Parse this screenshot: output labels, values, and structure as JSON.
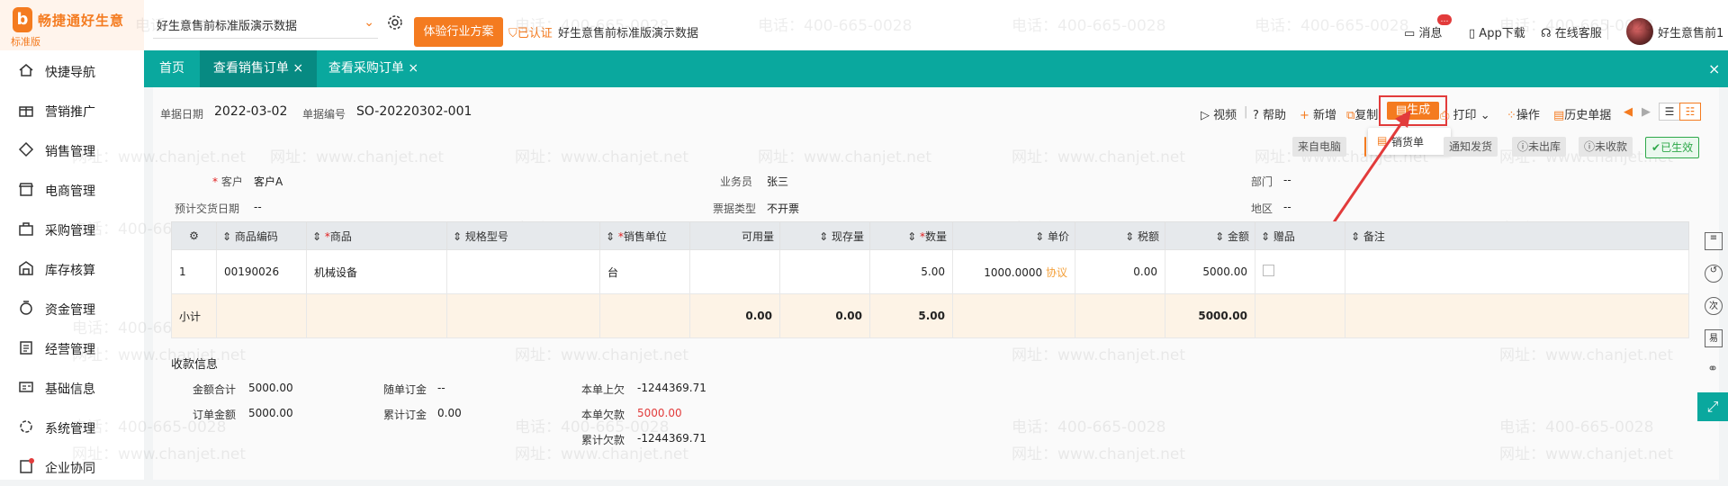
{
  "app": {
    "brand": "畅捷通好生意",
    "edition": "标准版"
  },
  "sidebar": {
    "items": [
      {
        "label": "快捷导航",
        "icon": "home-icon"
      },
      {
        "label": "营销推广",
        "icon": "gift-icon"
      },
      {
        "label": "销售管理",
        "icon": "sales-icon"
      },
      {
        "label": "电商管理",
        "icon": "shop-icon"
      },
      {
        "label": "采购管理",
        "icon": "bag-icon"
      },
      {
        "label": "库存核算",
        "icon": "warehouse-icon"
      },
      {
        "label": "资金管理",
        "icon": "money-icon"
      },
      {
        "label": "经营管理",
        "icon": "clipboard-icon"
      },
      {
        "label": "基础信息",
        "icon": "id-card-icon"
      },
      {
        "label": "系统管理",
        "icon": "system-icon"
      },
      {
        "label": "企业协同",
        "icon": "collab-icon"
      }
    ]
  },
  "header": {
    "account": "好生意售前标准版演示数据",
    "industry_button": "体验行业方案",
    "verified": "已认证",
    "company": "好生意售前标准版演示数据",
    "messages": "消息",
    "message_badge": "…",
    "app_download": "App下载",
    "online_service": "在线客服",
    "user": "好生意售前1"
  },
  "tabs": [
    {
      "label": "首页"
    },
    {
      "label": "查看销售订单"
    },
    {
      "label": "查看采购订单"
    }
  ],
  "order": {
    "date_label": "单据日期",
    "date": "2022-03-02",
    "no_label": "单据编号",
    "no": "SO-20220302-001",
    "customer_label": "客户",
    "customer": "客户A",
    "delivery_label": "预计交货日期",
    "delivery": "--",
    "salesman_label": "业务员",
    "salesman": "张三",
    "invoice_label": "票据类型",
    "invoice": "不开票",
    "dept_label": "部门",
    "dept": "--",
    "region_label": "地区",
    "region": "--"
  },
  "toolbar": {
    "video": "视频",
    "help": "帮助",
    "add": "新增",
    "copy": "复制",
    "generate": "生成",
    "print": "打印",
    "operate": "操作",
    "history": "历史单据",
    "dropdown_item": "销货单"
  },
  "status": {
    "source": "来自电脑",
    "notify": "通知发货",
    "not_out": "未出库",
    "not_collected": "未收款",
    "effective": "已生效"
  },
  "grid": {
    "headers": [
      "商品编码",
      "商品",
      "规格型号",
      "销售单位",
      "可用量",
      "现存量",
      "数量",
      "单价",
      "税额",
      "金额",
      "赠品",
      "备注"
    ],
    "row": {
      "idx": "1",
      "code": "00190026",
      "name": "机械设备",
      "spec": "",
      "unit": "台",
      "available": "",
      "stock": "",
      "qty": "5.00",
      "price": "1000.0000",
      "price_tag": "协议",
      "tax": "0.00",
      "amount": "5000.00"
    },
    "subtotal": {
      "label": "小计",
      "available": "0.00",
      "stock": "0.00",
      "qty": "5.00",
      "amount": "5000.00"
    }
  },
  "payment": {
    "title": "收款信息",
    "total_label": "金额合计",
    "total": "5000.00",
    "deposit_label": "随单订金",
    "deposit": "--",
    "prev_owed_label": "本单上欠",
    "prev_owed": "-1244369.71",
    "order_amount_label": "订单金额",
    "order_amount": "5000.00",
    "cum_deposit_label": "累计订金",
    "cum_deposit": "0.00",
    "owed_label": "本单欠款",
    "owed": "5000.00",
    "cum_owed_label": "累计欠款",
    "cum_owed": "-1244369.71"
  },
  "watermark": {
    "phone": "电话：400-665-0028",
    "site": "网址：www.chanjet.net"
  },
  "colors": {
    "accent": "#f47b20",
    "teal": "#0aa89e",
    "alert": "#e23b3b",
    "effective": "#2ea84a"
  }
}
